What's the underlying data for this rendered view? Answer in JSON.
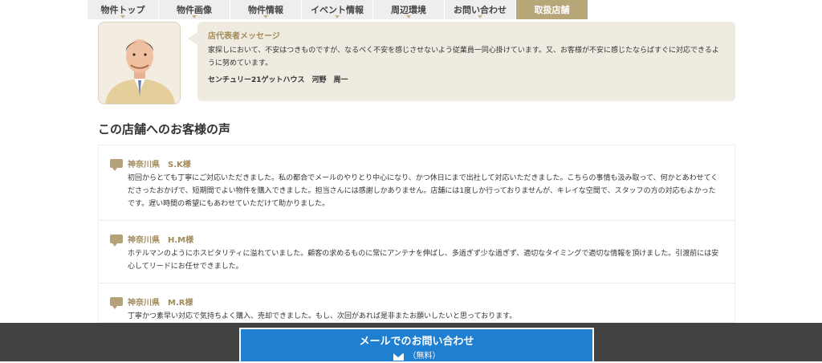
{
  "nav": {
    "items": [
      {
        "label": "物件トップ",
        "active": false
      },
      {
        "label": "物件画像",
        "active": false
      },
      {
        "label": "物件情報",
        "active": false
      },
      {
        "label": "イベント情報",
        "active": false
      },
      {
        "label": "周辺環境",
        "active": false
      },
      {
        "label": "お問い合わせ",
        "active": false
      },
      {
        "label": "取扱店舗",
        "active": true
      }
    ]
  },
  "message": {
    "heading": "店代表者メッセージ",
    "body": "家探しにおいて、不安はつきものですが、なるべく不安を感じさせないよう従業員一同心掛けています。又、お客様が不安に感じたならばすぐに対応できるように努めています。",
    "signature": "センチュリー21ゲットハウス　河野　周一"
  },
  "reviews": {
    "title": "この店舗へのお客様の声",
    "items": [
      {
        "name": "神奈川県　S.K様",
        "text": "初回からとても丁寧にご対応いただきました。私の都合でメールのやりとり中心になり、かつ休日にまで出社して対応いただきました。こちらの事情も汲み取って、何かとあわせてくださったおかげで、短期間でよい物件を購入できました。担当さんには感謝しかありません。店舗には1度しか行っておりませんが、キレイな空間で、スタッフの方の対応もよかったです。遅い時間の希望にもあわせていただけて助かりました。"
      },
      {
        "name": "神奈川県　H.M様",
        "text": "ホテルマンのようにホスピタリティに溢れていました。顧客の求めるものに常にアンテナを伸ばし、多過ぎず少な過ぎず、適切なタイミングで適切な情報を頂けました。引渡前には安心してリードにお任せできました。"
      },
      {
        "name": "神奈川県　M.R様",
        "text": "丁寧かつ素早い対応で気持ちよく購入、売却できました。もし、次回があれば是非またお願いしたいと思っております。"
      }
    ]
  },
  "footer": {
    "mail_label": "メールでのお問い合わせ",
    "mail_sub": "（無料）"
  },
  "colors": {
    "accent": "#b7a678",
    "button": "#1f7fd0",
    "footer": "#424242"
  }
}
